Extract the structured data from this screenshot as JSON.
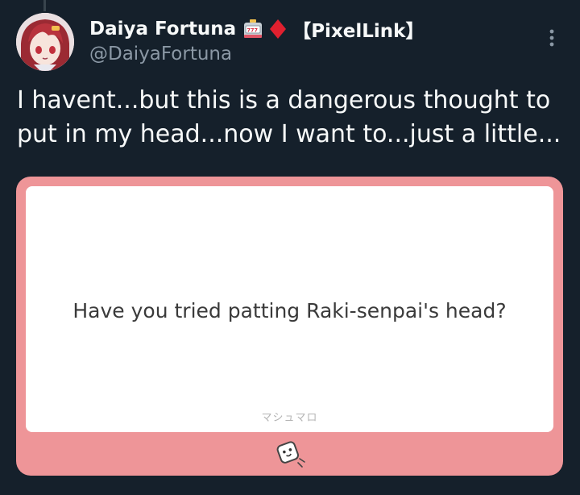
{
  "tweet": {
    "author": {
      "display_name": "Daiya Fortuna",
      "emojis": [
        "slot-machine-icon",
        "red-diamond-icon"
      ],
      "tag": "【PixelLink】",
      "handle": "@DaiyaFortuna"
    },
    "text": "I havent...but this is a dangerous thought to put in my head...now I want to...just a little...",
    "card": {
      "question": "Have you tried patting Raki-senpai's head?",
      "brand": "マシュマロ",
      "mascot_icon": "marshmallow-mascot-icon",
      "accent_color": "#ee9598"
    }
  },
  "colors": {
    "background": "#15202b",
    "text_primary": "#f7f9f9",
    "text_secondary": "#8b98a5"
  }
}
